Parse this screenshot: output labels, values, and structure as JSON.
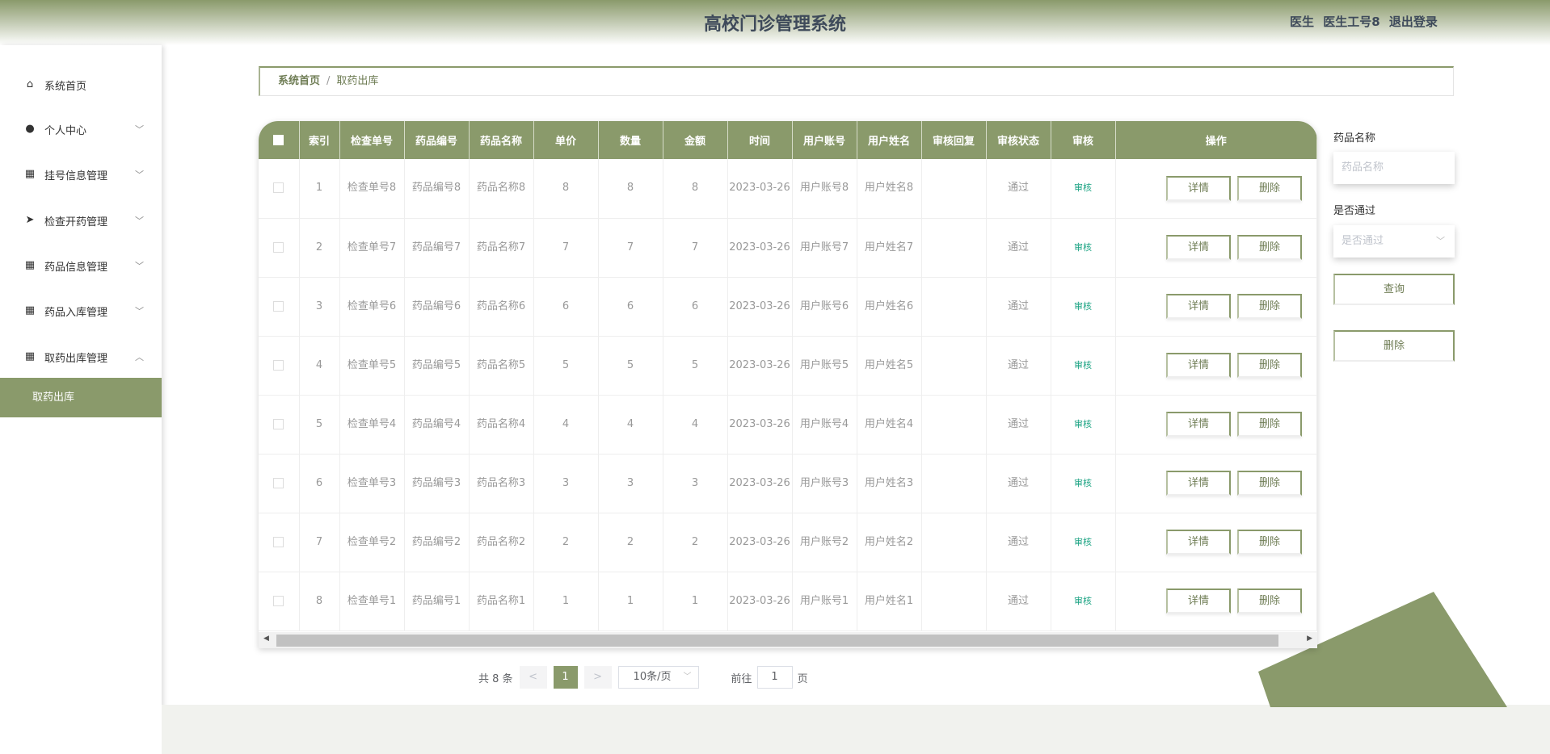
{
  "header": {
    "title": "高校门诊管理系统",
    "role": "医生",
    "username": "医生工号8",
    "logout": "退出登录"
  },
  "sidebar": {
    "items": [
      {
        "label": "系统首页",
        "icon": "home-icon",
        "chevron": ""
      },
      {
        "label": "个人中心",
        "icon": "user-icon",
        "chevron": "down"
      },
      {
        "label": "挂号信息管理",
        "icon": "grid-icon",
        "chevron": "down"
      },
      {
        "label": "检查开药管理",
        "icon": "send-icon",
        "chevron": "down"
      },
      {
        "label": "药品信息管理",
        "icon": "grid-icon",
        "chevron": "down"
      },
      {
        "label": "药品入库管理",
        "icon": "grid-icon",
        "chevron": "down"
      },
      {
        "label": "取药出库管理",
        "icon": "grid-icon",
        "chevron": "up"
      }
    ],
    "sub_item": "取药出库"
  },
  "breadcrumb": {
    "home": "系统首页",
    "sep": "/",
    "current": "取药出库"
  },
  "table": {
    "headers": [
      "索引",
      "检查单号",
      "药品编号",
      "药品名称",
      "单价",
      "数量",
      "金额",
      "时间",
      "用户账号",
      "用户姓名",
      "审核回复",
      "审核状态",
      "审核",
      "操作"
    ],
    "rows": [
      [
        "1",
        "检查单号8",
        "药品编号8",
        "药品名称8",
        "8",
        "8",
        "8",
        "2023-03-26",
        "用户账号8",
        "用户姓名8",
        "",
        "通过",
        "审核"
      ],
      [
        "2",
        "检查单号7",
        "药品编号7",
        "药品名称7",
        "7",
        "7",
        "7",
        "2023-03-26",
        "用户账号7",
        "用户姓名7",
        "",
        "通过",
        "审核"
      ],
      [
        "3",
        "检查单号6",
        "药品编号6",
        "药品名称6",
        "6",
        "6",
        "6",
        "2023-03-26",
        "用户账号6",
        "用户姓名6",
        "",
        "通过",
        "审核"
      ],
      [
        "4",
        "检查单号5",
        "药品编号5",
        "药品名称5",
        "5",
        "5",
        "5",
        "2023-03-26",
        "用户账号5",
        "用户姓名5",
        "",
        "通过",
        "审核"
      ],
      [
        "5",
        "检查单号4",
        "药品编号4",
        "药品名称4",
        "4",
        "4",
        "4",
        "2023-03-26",
        "用户账号4",
        "用户姓名4",
        "",
        "通过",
        "审核"
      ],
      [
        "6",
        "检查单号3",
        "药品编号3",
        "药品名称3",
        "3",
        "3",
        "3",
        "2023-03-26",
        "用户账号3",
        "用户姓名3",
        "",
        "通过",
        "审核"
      ],
      [
        "7",
        "检查单号2",
        "药品编号2",
        "药品名称2",
        "2",
        "2",
        "2",
        "2023-03-26",
        "用户账号2",
        "用户姓名2",
        "",
        "通过",
        "审核"
      ],
      [
        "8",
        "检查单号1",
        "药品编号1",
        "药品名称1",
        "1",
        "1",
        "1",
        "2023-03-26",
        "用户账号1",
        "用户姓名1",
        "",
        "通过",
        "审核"
      ]
    ],
    "detail_label": "详情",
    "delete_label": "删除"
  },
  "filters": {
    "name_label": "药品名称",
    "name_placeholder": "药品名称",
    "pass_label": "是否通过",
    "pass_placeholder": "是否通过",
    "search": "查询",
    "delete": "删除"
  },
  "pagination": {
    "total": "共 8 条",
    "prev": "<",
    "page": "1",
    "next": ">",
    "size": "10条/页",
    "goto": "前往",
    "goto_value": "1",
    "page_suffix": "页"
  },
  "colors": {
    "accent": "#8a9a6b",
    "audit": "#1aa382"
  }
}
